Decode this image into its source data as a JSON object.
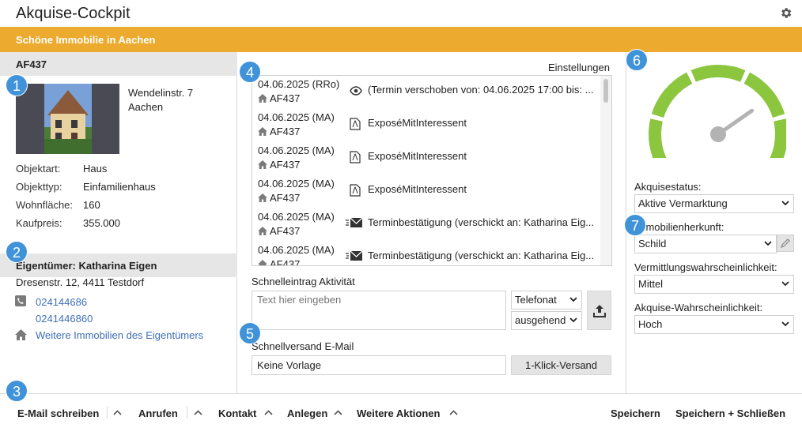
{
  "app": {
    "title": "Akquise-Cockpit"
  },
  "banner": {
    "title": "Schöne Immobilie in Aachen"
  },
  "property": {
    "id": "AF437",
    "street": "Wendelinstr. 7",
    "city": "Aachen",
    "details": [
      {
        "label": "Objektart:",
        "value": "Haus"
      },
      {
        "label": "Objekttyp:",
        "value": "Einfamilienhaus"
      },
      {
        "label": "Wohnfläche:",
        "value": "160"
      },
      {
        "label": "Kaufpreis:",
        "value": "355.000"
      }
    ]
  },
  "owner": {
    "heading": "Eigentümer: Katharina Eigen",
    "address": "Dresenstr. 12, 4411 Testdorf",
    "phones": [
      "024144686",
      "0241446860"
    ],
    "more_link": "Weitere Immobilien des Eigentümers"
  },
  "activities": {
    "settings_label": "Einstellungen",
    "items": [
      {
        "date": "04.06.2025 (RRo)",
        "object": "AF437",
        "icon": "eye-icon",
        "text": "(Termin verschoben von: 04.06.2025 17:00 bis: ..."
      },
      {
        "date": "04.06.2025 (MA)",
        "object": "AF437",
        "icon": "pdf-icon",
        "text": "ExposéMitInteressent"
      },
      {
        "date": "04.06.2025 (MA)",
        "object": "AF437",
        "icon": "pdf-icon",
        "text": "ExposéMitInteressent"
      },
      {
        "date": "04.06.2025 (MA)",
        "object": "AF437",
        "icon": "pdf-icon",
        "text": "ExposéMitInteressent"
      },
      {
        "date": "04.06.2025 (MA)",
        "object": "AF437",
        "icon": "email-sent-icon",
        "text": "Terminbestätigung (verschickt an: Katharina Eig..."
      },
      {
        "date": "04.06.2025 (MA)",
        "object": "AF437",
        "icon": "email-sent-icon",
        "text": "Terminbestätigung (verschickt an: Katharina Eig..."
      }
    ]
  },
  "quick_entry": {
    "label": "Schnelleintrag Aktivität",
    "placeholder": "Text hier eingeben",
    "type_value": "Telefonat",
    "direction_value": "ausgehend"
  },
  "quick_mail": {
    "label": "Schnellversand E-Mail",
    "template_value": "Keine Vorlage",
    "send_label": "1-Klick-Versand"
  },
  "status_panel": {
    "gauge_level": 0.72,
    "fields": [
      {
        "label": "Akquisestatus:",
        "value": "Aktive Vermarktung"
      },
      {
        "label": "Immobilienherkunft:",
        "value": "Schild"
      },
      {
        "label": "Vermittlungswahrscheinlichkeit:",
        "value": "Mittel"
      },
      {
        "label": "Akquise-Wahrscheinlichkeit:",
        "value": "Hoch"
      }
    ]
  },
  "badges": [
    "1",
    "2",
    "3",
    "4",
    "5",
    "6",
    "7"
  ],
  "bottombar": {
    "left": [
      "E-Mail schreiben",
      "Anrufen",
      "Kontakt",
      "Anlegen",
      "Weitere Aktionen"
    ],
    "save": "Speichern",
    "save_close": "Speichern + Schließen"
  },
  "colors": {
    "accent": "#ecab2e",
    "link": "#3d6fb6",
    "badge": "#4193d9",
    "gauge": "#8cc63f"
  }
}
